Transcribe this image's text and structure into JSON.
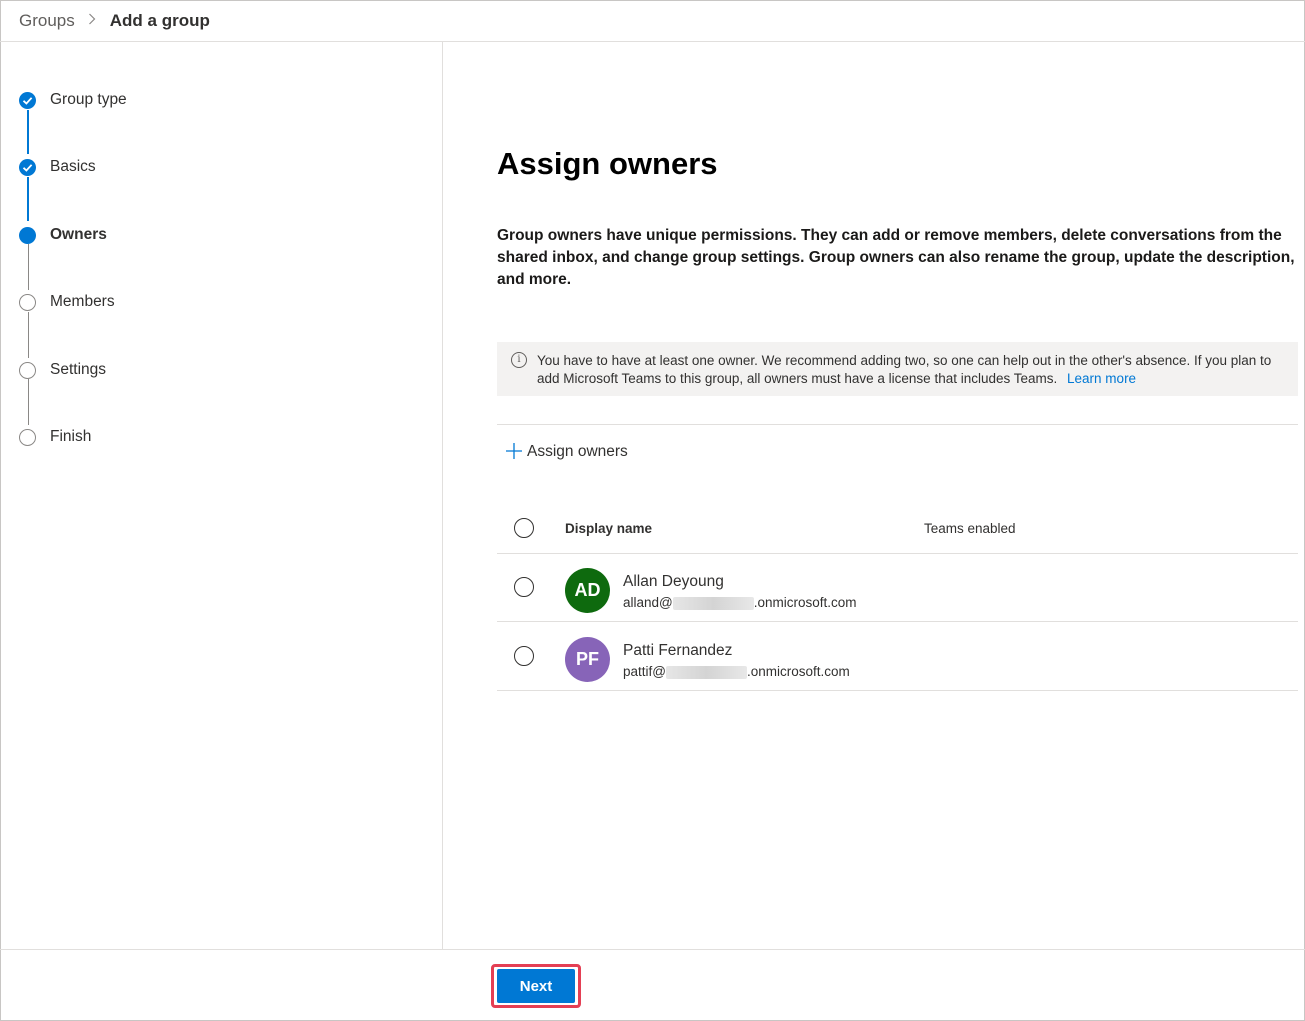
{
  "breadcrumb": {
    "root": "Groups",
    "separator": ">",
    "current": "Add a group"
  },
  "wizard": {
    "steps": [
      {
        "label": "Group type",
        "state": "done"
      },
      {
        "label": "Basics",
        "state": "done"
      },
      {
        "label": "Owners",
        "state": "current"
      },
      {
        "label": "Members",
        "state": "todo"
      },
      {
        "label": "Settings",
        "state": "todo"
      },
      {
        "label": "Finish",
        "state": "todo"
      }
    ]
  },
  "main": {
    "title": "Assign owners",
    "description": "Group owners have unique permissions. They can add or remove members, delete conversations from the shared inbox, and change group settings. Group owners can also rename the group, update the description, and more.",
    "info": {
      "text": "You have to have at least one owner. We recommend adding two, so one can help out in the other's absence. If you plan to add Microsoft Teams to this group, all owners must have a license that includes Teams.",
      "link": "Learn more"
    },
    "assign_button": "Assign owners",
    "table": {
      "columns": [
        "Display name",
        "Teams enabled"
      ],
      "rows": [
        {
          "initials": "AD",
          "name": "Allan Deyoung",
          "email_prefix": "alland@",
          "email_suffix": ".onmicrosoft.com",
          "avatar_color": "#0e6a0e"
        },
        {
          "initials": "PF",
          "name": "Patti Fernandez",
          "email_prefix": "pattif@",
          "email_suffix": ".onmicrosoft.com",
          "avatar_color": "#8764b8"
        }
      ]
    }
  },
  "footer": {
    "next_label": "Next"
  },
  "colors": {
    "accent": "#0078d4",
    "highlight": "#e43f54"
  }
}
